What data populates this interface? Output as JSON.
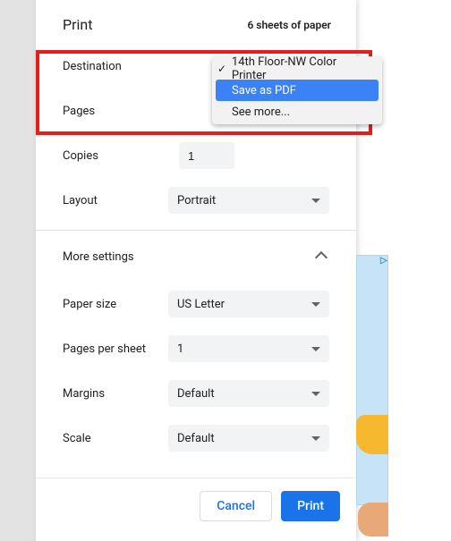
{
  "header": {
    "title": "Print",
    "sheets": "6 sheets of paper"
  },
  "destination": {
    "label": "Destination",
    "options": [
      {
        "label": "14th Floor-NW Color Printer",
        "selected": true
      },
      {
        "label": "Save as PDF",
        "highlighted": true
      },
      {
        "label": "See more..."
      }
    ]
  },
  "pages": {
    "label": "Pages"
  },
  "copies": {
    "label": "Copies",
    "value": "1"
  },
  "layout": {
    "label": "Layout",
    "value": "Portrait"
  },
  "moreSettings": {
    "label": "More settings",
    "expanded": true
  },
  "paperSize": {
    "label": "Paper size",
    "value": "US Letter"
  },
  "pagesPerSheet": {
    "label": "Pages per sheet",
    "value": "1"
  },
  "margins": {
    "label": "Margins",
    "value": "Default"
  },
  "scale": {
    "label": "Scale",
    "value": "Default"
  },
  "footer": {
    "cancel": "Cancel",
    "print": "Print"
  }
}
